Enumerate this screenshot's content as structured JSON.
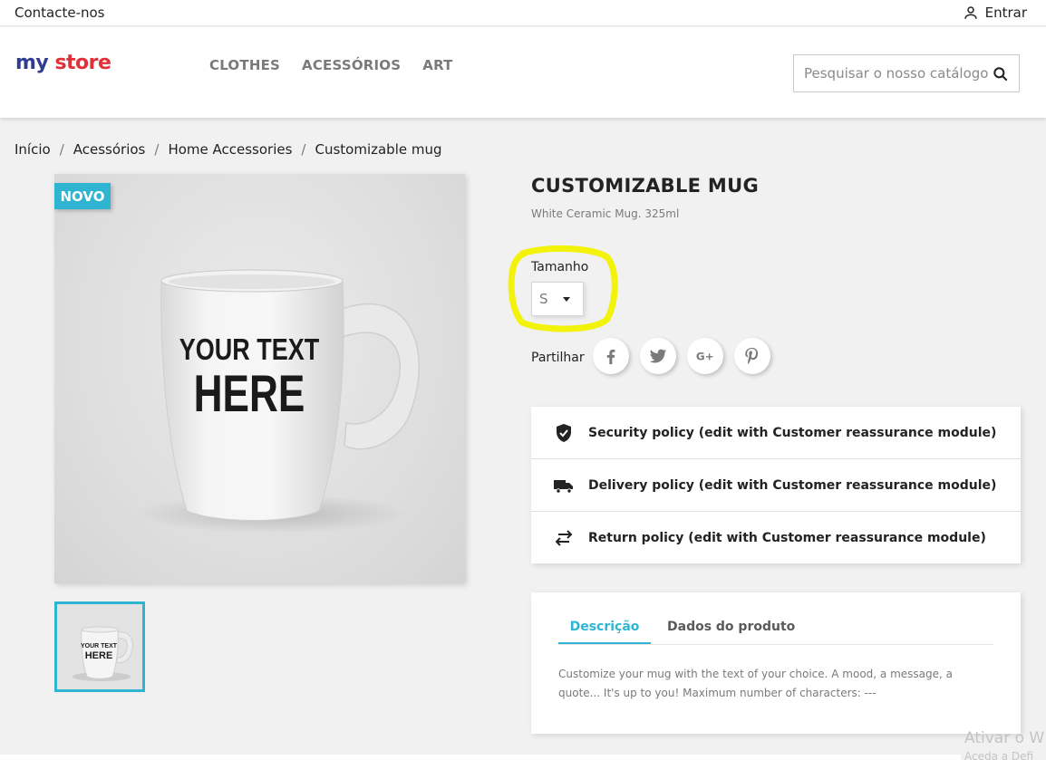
{
  "topbar": {
    "contact": "Contacte-nos",
    "signin": "Entrar"
  },
  "logo": {
    "word1": "my",
    "word2": "store"
  },
  "nav": [
    "CLOTHES",
    "ACESSÓRIOS",
    "ART"
  ],
  "search": {
    "placeholder": "Pesquisar o nosso catálogo"
  },
  "breadcrumb": [
    "Início",
    "Acessórios",
    "Home Accessories",
    "Customizable mug"
  ],
  "product": {
    "badge": "NOVO",
    "image_text_line1": "YOUR TEXT",
    "image_text_line2": "HERE",
    "title": "CUSTOMIZABLE MUG",
    "subtitle": "White Ceramic Mug. 325ml",
    "size_label": "Tamanho",
    "size_value": "S",
    "share_label": "Partilhar"
  },
  "reassurance": [
    {
      "icon": "shield-check-icon",
      "text": "Security policy (edit with Customer reassurance module)"
    },
    {
      "icon": "truck-icon",
      "text": "Delivery policy (edit with Customer reassurance module)"
    },
    {
      "icon": "swap-arrows-icon",
      "text": "Return policy (edit with Customer reassurance module)"
    }
  ],
  "tabs": {
    "active": "Descrição",
    "inactive": "Dados do produto"
  },
  "description": "Customize your mug with the text of your choice. A mood, a message, a quote... It's up to you! Maximum number of characters: ---",
  "watermark": {
    "line1": "Ativar o W",
    "line2": "Aceda a Defi"
  },
  "colors": {
    "accent": "#2fb5d2",
    "highlight": "#f2f20a"
  }
}
